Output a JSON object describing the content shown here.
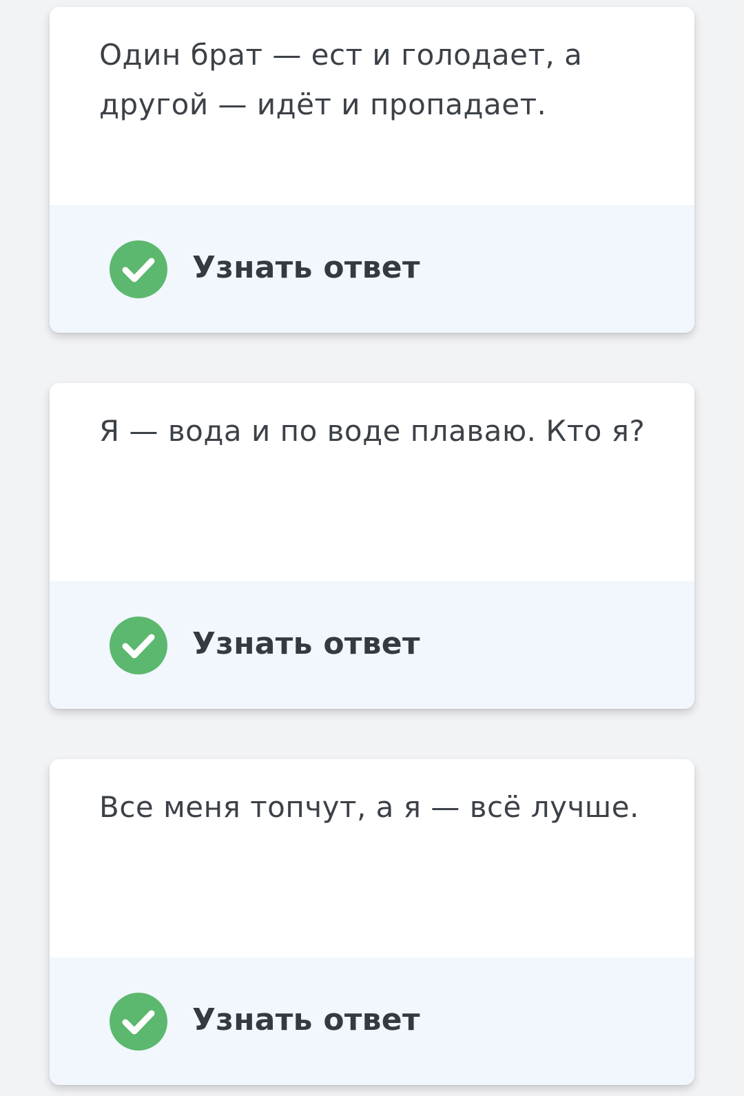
{
  "cards": [
    {
      "question": "Один брат — ест и голодает, а другой — идёт и пропадает.",
      "answer_button_label": "Узнать ответ",
      "icon": "check-circle-icon"
    },
    {
      "question": "Я — вода и по воде плаваю. Кто я?",
      "answer_button_label": "Узнать ответ",
      "icon": "check-circle-icon"
    },
    {
      "question": "Все меня топчут, а я — всё лучше.",
      "answer_button_label": "Узнать ответ",
      "icon": "check-circle-icon"
    }
  ],
  "colors": {
    "page_background": "#f2f3f5",
    "card_background": "#ffffff",
    "answer_bar_background": "#f1f7fc",
    "check_green": "#5cb86e",
    "text": "#3c4148",
    "label_text": "#353a42"
  }
}
